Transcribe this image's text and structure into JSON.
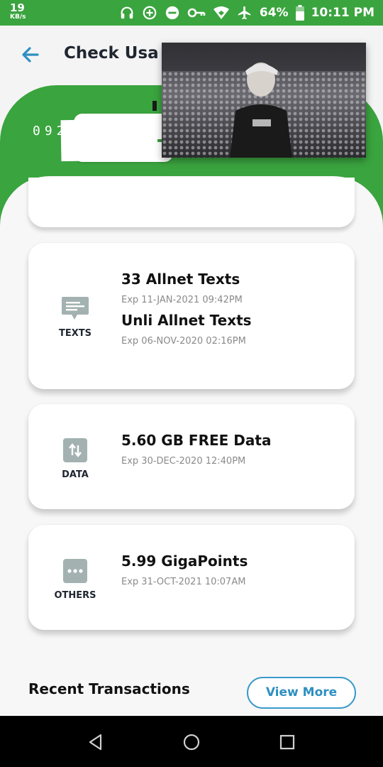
{
  "status_bar": {
    "net_speed": "19",
    "net_unit": "KB/s",
    "battery": "64%",
    "time": "10:11 PM",
    "icons": [
      "headphones-icon",
      "data-saver-icon",
      "do-not-disturb-icon",
      "vpn-key-icon",
      "wifi-icon",
      "airplane-icon",
      "battery-icon"
    ]
  },
  "app_bar": {
    "title": "Check Usa"
  },
  "account": {
    "number_visible": "092"
  },
  "cards": [
    {
      "category": "TEXTS",
      "icon": "message-icon",
      "items": [
        {
          "title": "33 Allnet Texts",
          "expiry": "Exp 11-JAN-2021 09:42PM"
        },
        {
          "title": "Unli Allnet Texts",
          "expiry": "Exp 06-NOV-2020 02:16PM"
        }
      ]
    },
    {
      "category": "DATA",
      "icon": "data-transfer-icon",
      "items": [
        {
          "title": "5.60 GB FREE Data",
          "expiry": "Exp 30-DEC-2020 12:40PM"
        }
      ]
    },
    {
      "category": "OTHERS",
      "icon": "more-dots-icon",
      "items": [
        {
          "title": "5.99 GigaPoints",
          "expiry": "Exp 31-OCT-2021 10:07AM"
        }
      ]
    }
  ],
  "recent": {
    "heading": "Recent Transactions",
    "view_more": "View More"
  },
  "colors": {
    "brand_green": "#3aa43e",
    "link_blue": "#2e8fc1",
    "icon_gray": "#a3b1b1"
  }
}
